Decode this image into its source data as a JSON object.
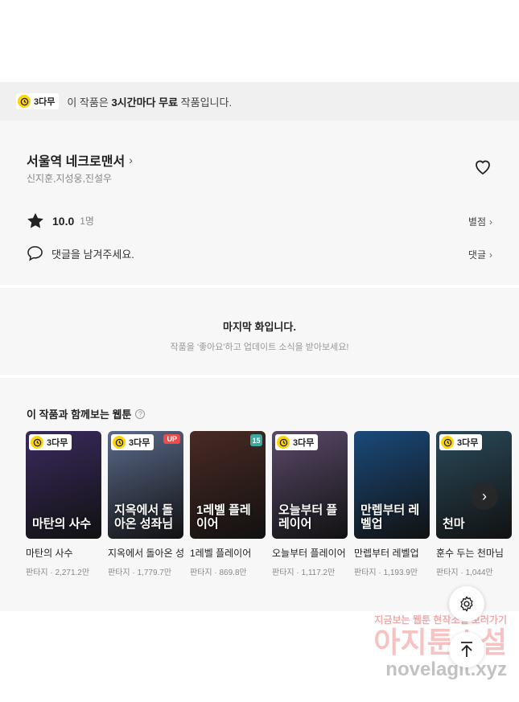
{
  "notice": {
    "badge": "3다무",
    "text_pre": "이 작품은 ",
    "text_bold": "3시간마다 무료",
    "text_post": " 작품입니다."
  },
  "work": {
    "title": "서울역 네크로맨서",
    "authors": "신지훈,지성웅,진설우",
    "rating": "10.0",
    "rating_count": "1명",
    "rating_link": "별점",
    "comment_prompt": "댓글을 남겨주세요.",
    "comment_link": "댓글"
  },
  "last_episode": {
    "heading": "마지막 화입니다.",
    "sub": "작품을 '좋아요'하고 업데이트 소식을 받아보세요!"
  },
  "recommend": {
    "title": "이 작품과 함께보는 웹툰",
    "help": "?",
    "items": [
      {
        "title": "마탄의 사수",
        "genre": "판타지",
        "views": "2,271.2만",
        "badge": "3다무",
        "flag": "",
        "art": "마탄의 사수",
        "color": "#3a2a5e"
      },
      {
        "title": "지옥에서 돌아온 성좌님",
        "genre": "판타지",
        "views": "1,779.7만",
        "badge": "3다무",
        "flag": "UP",
        "art": "지옥에서 돌아온 성좌님",
        "color": "#5a6a8a"
      },
      {
        "title": "1레벨 플레이어",
        "genre": "판타지",
        "views": "869.8만",
        "badge": "",
        "flag": "15",
        "art": "1레벨 플레이어",
        "color": "#4a2a24"
      },
      {
        "title": "오늘부터 플레이어",
        "genre": "판타지",
        "views": "1,117.2만",
        "badge": "3다무",
        "flag": "",
        "art": "오늘부터 플레이어",
        "color": "#5a4a6a"
      },
      {
        "title": "만렙부터 레벨업",
        "genre": "판타지",
        "views": "1,193.9만",
        "badge": "",
        "flag": "",
        "art": "만렙부터 레벨업",
        "color": "#1a4a7a"
      },
      {
        "title": "훈수 두는 천마님",
        "genre": "판타지",
        "views": "1,044만",
        "badge": "3다무",
        "flag": "",
        "art": "천마",
        "color": "#2a4a5a"
      }
    ]
  },
  "watermark": {
    "line1": "지금보는 웹툰 현작소설 보러가기",
    "line2": "아지툰소설",
    "line3": "novelagit.xyz"
  },
  "icons": {
    "clock": "clock-icon",
    "heart": "heart-icon",
    "star": "star-icon",
    "comment": "comment-bubble-icon",
    "gear": "gear-icon",
    "top": "arrow-up-icon",
    "next": "chevron-right-icon"
  },
  "colors": {
    "accent": "#ffd400",
    "up_badge": "#f04a4a",
    "age_badge": "#3aa9a0"
  }
}
